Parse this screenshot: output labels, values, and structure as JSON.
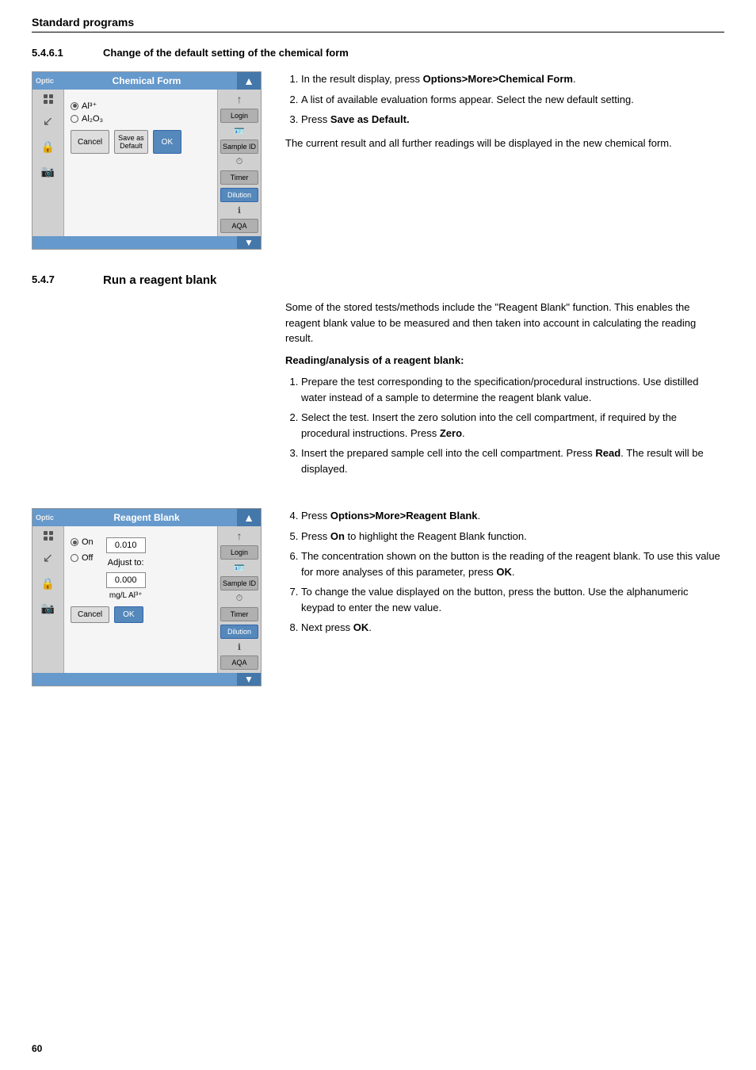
{
  "page": {
    "section_title": "Standard programs",
    "subsection_541": {
      "number": "5.4.6.1",
      "title": "Change of the default setting of the chemical form"
    },
    "subsection_547": {
      "number": "5.4.7",
      "title": "Run a reagent blank"
    },
    "page_number": "60"
  },
  "chemical_form": {
    "screen_label": "Optic",
    "dialog_title": "Chemical Form",
    "option1": "Al³⁺",
    "option2": "Al₂O₃",
    "cancel_btn": "Cancel",
    "save_default_btn": "Save as Default",
    "ok_btn": "OK",
    "sidebar": {
      "login": "Login",
      "sample_id": "Sample ID",
      "timer": "Timer",
      "dilution": "Dilution",
      "aqa": "AQA"
    }
  },
  "reagent_blank": {
    "screen_label": "Optic",
    "dialog_title": "Reagent Blank",
    "on_label": "On",
    "off_label": "Off",
    "value": "0.010",
    "adjust_to_label": "Adjust to:",
    "adjust_value": "0.000",
    "unit": "mg/L Al³⁺",
    "cancel_btn": "Cancel",
    "ok_btn": "OK",
    "sidebar": {
      "login": "Login",
      "sample_id": "Sample ID",
      "timer": "Timer",
      "dilution": "Dilution",
      "aqa": "AQA"
    }
  },
  "instructions_541": {
    "step1": "In the result display, press ",
    "step1_bold": "Options>More>Chemical Form",
    "step2": "A list of available evaluation forms appear. Select the new default setting.",
    "step3_prefix": "Press ",
    "step3_bold": "Save as Default.",
    "result_text": "The current result and all further readings will be displayed in the new chemical form."
  },
  "instructions_547": {
    "intro": "Some of the stored tests/methods include the \"Reagent Blank\" function. This enables the reagent blank value to be measured and then taken into account in calculating the reading result.",
    "reading_label": "Reading/analysis of a reagent blank:",
    "step1": "Prepare the test corresponding to the specification/procedural instructions. Use distilled water instead of a sample to determine the reagent blank value.",
    "step2_prefix": "Select the test. Insert the zero solution into the cell compartment, if required by the procedural instructions. Press ",
    "step2_bold": "Zero",
    "step2_suffix": ".",
    "step3_prefix": "Insert the prepared sample cell into the cell compartment. Press ",
    "step3_bold": "Read",
    "step3_suffix": ". The result will be displayed.",
    "step4_prefix": "Press ",
    "step4_bold": "Options>More>Reagent Blank",
    "step4_suffix": ".",
    "step5_prefix": "Press ",
    "step5_bold": "On",
    "step5_suffix": " to highlight the Reagent Blank function.",
    "step6": "The concentration shown on the button is the reading of the reagent blank. To use this value for more analyses of this parameter, press ",
    "step6_bold": "OK",
    "step6_suffix": ".",
    "step7_prefix": "To change the value displayed on the button, press the button. Use the alphanumeric keypad to enter the new value.",
    "step8_prefix": "Next press ",
    "step8_bold": "OK",
    "step8_suffix": "."
  }
}
